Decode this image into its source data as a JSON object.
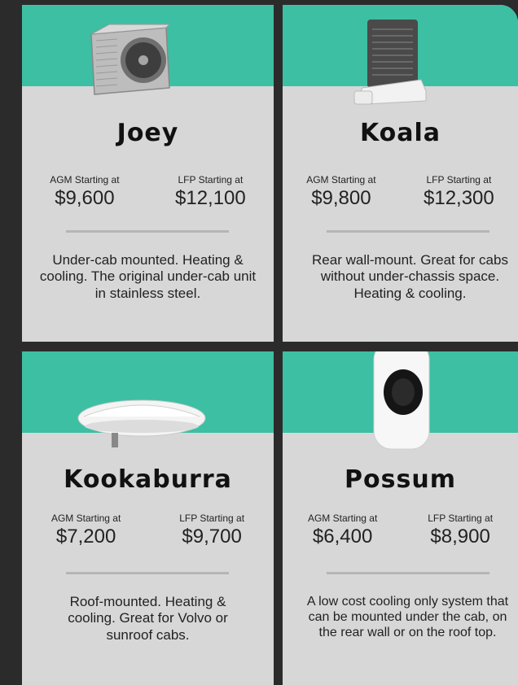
{
  "cards": [
    {
      "name": "Joey",
      "agm_label": "AGM Starting at",
      "agm_price": "$9,600",
      "lfp_label": "LFP Starting at",
      "lfp_price": "$12,100",
      "description": "Under-cab mounted. Heating & cooling. The original under-cab unit in stainless steel."
    },
    {
      "name": "Koala",
      "agm_label": "AGM Starting at",
      "agm_price": "$9,800",
      "lfp_label": "LFP Starting at",
      "lfp_price": "$12,300",
      "description": "Rear wall-mount. Great for cabs without under-chassis space. Heating & cooling."
    },
    {
      "name": "Kookaburra",
      "agm_label": "AGM Starting at",
      "agm_price": "$7,200",
      "lfp_label": "LFP Starting at",
      "lfp_price": "$9,700",
      "description": "Roof-mounted. Heating & cooling. Great for Volvo or sunroof cabs."
    },
    {
      "name": "Possum",
      "agm_label": "AGM Starting at",
      "agm_price": "$6,400",
      "lfp_label": "LFP Starting at",
      "lfp_price": "$8,900",
      "description": "A low cost cooling only system that can be mounted under the cab, on the rear wall or on the roof top."
    }
  ],
  "colors": {
    "band": "#3dbfa3",
    "card": "#d7d7d7",
    "background": "#2b2b2b"
  }
}
